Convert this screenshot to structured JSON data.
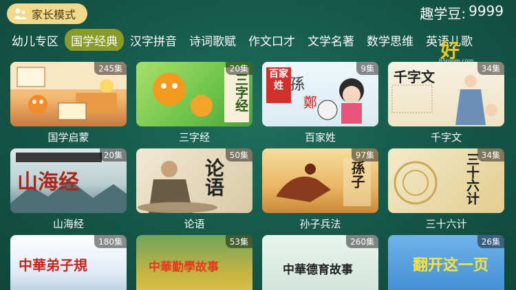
{
  "header": {
    "parent_mode_label": "家长模式",
    "coins_label": "趣学豆:",
    "coins_value": "9999"
  },
  "tabs": [
    {
      "label": "幼儿专区",
      "active": false
    },
    {
      "label": "国学经典",
      "active": true
    },
    {
      "label": "汉字拼音",
      "active": false
    },
    {
      "label": "诗词歌赋",
      "active": false
    },
    {
      "label": "作文口才",
      "active": false
    },
    {
      "label": "文学名著",
      "active": false
    },
    {
      "label": "数学思维",
      "active": false
    },
    {
      "label": "英语儿歌",
      "active": false
    }
  ],
  "logo": {
    "text": "好",
    "sub": "h5room.com"
  },
  "cards": [
    {
      "title": "国学启蒙",
      "episodes": "245集",
      "thumb_text": ""
    },
    {
      "title": "三字经",
      "episodes": "20集",
      "thumb_text": "三字经"
    },
    {
      "title": "百家姓",
      "episodes": "9集",
      "thumb_text": "百家姓"
    },
    {
      "title": "千字文",
      "episodes": "34集",
      "thumb_text": "千字文"
    },
    {
      "title": "山海经",
      "episodes": "20集",
      "thumb_text": "山海经"
    },
    {
      "title": "论语",
      "episodes": "50集",
      "thumb_text": "论语"
    },
    {
      "title": "孙子兵法",
      "episodes": "97集",
      "thumb_text": "孫子"
    },
    {
      "title": "三十六计",
      "episodes": "34集",
      "thumb_text": "三十六计"
    },
    {
      "title": "",
      "episodes": "180集",
      "thumb_text": "中華弟子規"
    },
    {
      "title": "",
      "episodes": "53集",
      "thumb_text": "中華勤學故事"
    },
    {
      "title": "",
      "episodes": "260集",
      "thumb_text": "中華德育故事"
    },
    {
      "title": "",
      "episodes": "26集",
      "thumb_text": "翻开这一页"
    }
  ],
  "colors": {
    "active_tab": "#8a9a2b",
    "parent_btn": "#f2d98c",
    "background": "#175a4b"
  }
}
